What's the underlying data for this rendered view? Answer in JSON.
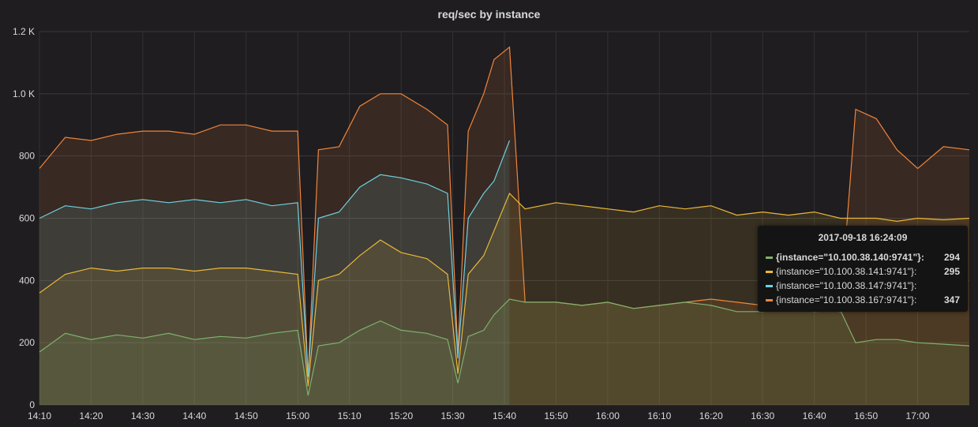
{
  "panel": {
    "title": "req/sec by instance"
  },
  "tooltip": {
    "time": "2017-09-18 16:24:09",
    "rows": [
      {
        "name": "{instance=\"10.100.38.140:9741\"}:",
        "value": "294",
        "color": "#7eb26d",
        "bold": true
      },
      {
        "name": "{instance=\"10.100.38.141:9741\"}:",
        "value": "295",
        "color": "#eab839",
        "bold": false
      },
      {
        "name": "{instance=\"10.100.38.147:9741\"}:",
        "value": "",
        "color": "#6ed0e0",
        "bold": false
      },
      {
        "name": "{instance=\"10.100.38.167:9741\"}:",
        "value": "347",
        "color": "#ef843c",
        "bold": false
      }
    ]
  },
  "chart_data": {
    "type": "area",
    "title": "req/sec by instance",
    "xlabel": "",
    "ylabel": "",
    "x_range": [
      "14:10",
      "17:10"
    ],
    "ylim": [
      0,
      1200
    ],
    "yticks": [
      0,
      200,
      400,
      600,
      800,
      1000,
      1200
    ],
    "ytick_labels": [
      "0",
      "200",
      "400",
      "600",
      "800",
      "1.0 K",
      "1.2 K"
    ],
    "xtick_labels": [
      "14:10",
      "14:20",
      "14:30",
      "14:40",
      "14:50",
      "15:00",
      "15:10",
      "15:20",
      "15:30",
      "15:40",
      "15:50",
      "16:00",
      "16:10",
      "16:20",
      "16:30",
      "16:40",
      "16:50",
      "17:00"
    ],
    "grid": true,
    "fill": true,
    "series": [
      {
        "name": "{instance=\"10.100.38.140:9741\"}",
        "color": "#7eb26d",
        "points": [
          [
            "14:10",
            170
          ],
          [
            "14:15",
            230
          ],
          [
            "14:20",
            210
          ],
          [
            "14:25",
            225
          ],
          [
            "14:30",
            215
          ],
          [
            "14:35",
            230
          ],
          [
            "14:40",
            210
          ],
          [
            "14:45",
            220
          ],
          [
            "14:50",
            215
          ],
          [
            "14:55",
            230
          ],
          [
            "15:00",
            240
          ],
          [
            "15:02",
            30
          ],
          [
            "15:04",
            190
          ],
          [
            "15:08",
            200
          ],
          [
            "15:12",
            240
          ],
          [
            "15:16",
            270
          ],
          [
            "15:20",
            240
          ],
          [
            "15:25",
            230
          ],
          [
            "15:29",
            210
          ],
          [
            "15:31",
            70
          ],
          [
            "15:33",
            220
          ],
          [
            "15:36",
            240
          ],
          [
            "15:38",
            290
          ],
          [
            "15:41",
            340
          ],
          [
            "15:44",
            330
          ],
          [
            "15:50",
            330
          ],
          [
            "15:55",
            320
          ],
          [
            "16:00",
            330
          ],
          [
            "16:05",
            310
          ],
          [
            "16:10",
            320
          ],
          [
            "16:15",
            330
          ],
          [
            "16:20",
            320
          ],
          [
            "16:25",
            300
          ],
          [
            "16:30",
            300
          ],
          [
            "16:35",
            310
          ],
          [
            "16:40",
            300
          ],
          [
            "16:45",
            305
          ],
          [
            "16:48",
            200
          ],
          [
            "16:52",
            210
          ],
          [
            "16:56",
            210
          ],
          [
            "17:00",
            200
          ],
          [
            "17:05",
            195
          ],
          [
            "17:10",
            190
          ]
        ]
      },
      {
        "name": "{instance=\"10.100.38.141:9741\"}",
        "color": "#eab839",
        "points": [
          [
            "14:10",
            360
          ],
          [
            "14:15",
            420
          ],
          [
            "14:20",
            440
          ],
          [
            "14:25",
            430
          ],
          [
            "14:30",
            440
          ],
          [
            "14:35",
            440
          ],
          [
            "14:40",
            430
          ],
          [
            "14:45",
            440
          ],
          [
            "14:50",
            440
          ],
          [
            "14:55",
            430
          ],
          [
            "15:00",
            420
          ],
          [
            "15:02",
            60
          ],
          [
            "15:04",
            400
          ],
          [
            "15:08",
            420
          ],
          [
            "15:12",
            480
          ],
          [
            "15:16",
            530
          ],
          [
            "15:20",
            490
          ],
          [
            "15:25",
            470
          ],
          [
            "15:29",
            420
          ],
          [
            "15:31",
            100
          ],
          [
            "15:33",
            420
          ],
          [
            "15:36",
            480
          ],
          [
            "15:38",
            560
          ],
          [
            "15:41",
            680
          ],
          [
            "15:44",
            630
          ],
          [
            "15:50",
            650
          ],
          [
            "15:55",
            640
          ],
          [
            "16:00",
            630
          ],
          [
            "16:05",
            620
          ],
          [
            "16:10",
            640
          ],
          [
            "16:15",
            630
          ],
          [
            "16:20",
            640
          ],
          [
            "16:25",
            610
          ],
          [
            "16:30",
            620
          ],
          [
            "16:35",
            610
          ],
          [
            "16:40",
            620
          ],
          [
            "16:45",
            600
          ],
          [
            "16:48",
            600
          ],
          [
            "16:52",
            600
          ],
          [
            "16:56",
            590
          ],
          [
            "17:00",
            600
          ],
          [
            "17:05",
            595
          ],
          [
            "17:10",
            600
          ]
        ]
      },
      {
        "name": "{instance=\"10.100.38.147:9741\"}",
        "color": "#6ed0e0",
        "points": [
          [
            "14:10",
            600
          ],
          [
            "14:15",
            640
          ],
          [
            "14:20",
            630
          ],
          [
            "14:25",
            650
          ],
          [
            "14:30",
            660
          ],
          [
            "14:35",
            650
          ],
          [
            "14:40",
            660
          ],
          [
            "14:45",
            650
          ],
          [
            "14:50",
            660
          ],
          [
            "14:55",
            640
          ],
          [
            "15:00",
            650
          ],
          [
            "15:02",
            90
          ],
          [
            "15:04",
            600
          ],
          [
            "15:08",
            620
          ],
          [
            "15:12",
            700
          ],
          [
            "15:16",
            740
          ],
          [
            "15:20",
            730
          ],
          [
            "15:25",
            710
          ],
          [
            "15:29",
            680
          ],
          [
            "15:31",
            150
          ],
          [
            "15:33",
            600
          ],
          [
            "15:36",
            680
          ],
          [
            "15:38",
            720
          ],
          [
            "15:41",
            850
          ]
        ]
      },
      {
        "name": "{instance=\"10.100.38.167:9741\"}",
        "color": "#ef843c",
        "points": [
          [
            "14:10",
            760
          ],
          [
            "14:15",
            860
          ],
          [
            "14:20",
            850
          ],
          [
            "14:25",
            870
          ],
          [
            "14:30",
            880
          ],
          [
            "14:35",
            880
          ],
          [
            "14:40",
            870
          ],
          [
            "14:45",
            900
          ],
          [
            "14:50",
            900
          ],
          [
            "14:55",
            880
          ],
          [
            "15:00",
            880
          ],
          [
            "15:02",
            90
          ],
          [
            "15:04",
            820
          ],
          [
            "15:08",
            830
          ],
          [
            "15:12",
            960
          ],
          [
            "15:16",
            1000
          ],
          [
            "15:20",
            1000
          ],
          [
            "15:25",
            950
          ],
          [
            "15:29",
            900
          ],
          [
            "15:31",
            170
          ],
          [
            "15:33",
            880
          ],
          [
            "15:36",
            1000
          ],
          [
            "15:38",
            1110
          ],
          [
            "15:41",
            1150
          ],
          [
            "15:44",
            330
          ],
          [
            "15:50",
            330
          ],
          [
            "15:55",
            320
          ],
          [
            "16:00",
            330
          ],
          [
            "16:05",
            310
          ],
          [
            "16:10",
            320
          ],
          [
            "16:15",
            330
          ],
          [
            "16:20",
            340
          ],
          [
            "16:25",
            330
          ],
          [
            "16:30",
            320
          ],
          [
            "16:35",
            310
          ],
          [
            "16:40",
            310
          ],
          [
            "16:45",
            300
          ],
          [
            "16:48",
            950
          ],
          [
            "16:52",
            920
          ],
          [
            "16:56",
            820
          ],
          [
            "17:00",
            760
          ],
          [
            "17:05",
            830
          ],
          [
            "17:10",
            820
          ]
        ]
      }
    ]
  }
}
